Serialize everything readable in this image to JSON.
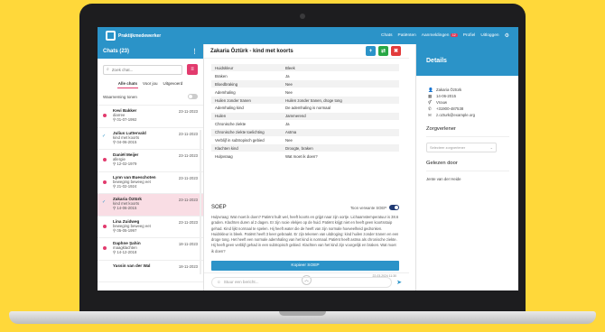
{
  "app": {
    "logo_text": "Praktijkmedewerker"
  },
  "topnav": {
    "items": [
      "Chats",
      "Patiënten"
    ],
    "notifications": "Aanmeldingen",
    "badge": "12",
    "profile": "Profiel",
    "logout": "Uitloggen",
    "settings_icon": "gear-icon"
  },
  "left": {
    "title": "Chats (23)",
    "search_placeholder": "Zoek chat...",
    "tabs": [
      "Alle chats",
      "Voor jou",
      "Uitgevoerd"
    ],
    "toggle_label": "Waarneming tonen",
    "chats": [
      {
        "name": "Kevi Bakker",
        "sub": "diarree",
        "date_line": "01-07-1992",
        "date": "23-11-2023",
        "marker": "dot"
      },
      {
        "name": "Julius Luttervald",
        "sub": "kind met koorts",
        "date_line": "04-06-2015",
        "date": "23-11-2023",
        "marker": "check"
      },
      {
        "name": "Daniël Meijer",
        "sub": "allergie",
        "date_line": "12-02-1979",
        "date": "23-11-2023",
        "marker": "dot"
      },
      {
        "name": "Lynn van Bueschoten",
        "sub": "beweging beweeg eet",
        "date_line": "21-02-1924",
        "date": "23-11-2023",
        "marker": "dot"
      },
      {
        "name": "Zakaria Öztürk",
        "sub": "kind met koorts",
        "date_line": "14-06-2015",
        "date": "23-11-2023",
        "marker": "check",
        "selected": true
      },
      {
        "name": "Lina Zuidweg",
        "sub": "beweging beweeg eet",
        "date_line": "05-05-1997",
        "date": "23-11-2023",
        "marker": "dot"
      },
      {
        "name": "Daphne Şahin",
        "sub": "maagklachten",
        "date_line": "14-12-2018",
        "date": "18-11-2023",
        "marker": "dot"
      },
      {
        "name": "Yassin van der Wal",
        "sub": "",
        "date_line": "",
        "date": "18-11-2023",
        "marker": "none"
      }
    ]
  },
  "middle": {
    "title": "Zakaria Öztürk - kind met koorts",
    "rows": [
      {
        "k": "Huidskleur",
        "v": "Bleek"
      },
      {
        "k": "Braken",
        "v": "Ja"
      },
      {
        "k": "Bloedbraking",
        "v": "Nee"
      },
      {
        "k": "Ademhaling",
        "v": "Nee"
      },
      {
        "k": "Huilen zonder tranen",
        "v": "Huilen zonder tranen, droge tong"
      },
      {
        "k": "Ademhaling kind",
        "v": "De ademhaling is normaal"
      },
      {
        "k": "Huilen",
        "v": "Jammerend"
      },
      {
        "k": "Chronische ziekte",
        "v": "Ja"
      },
      {
        "k": "Chronische ziekte toelichting",
        "v": "Astma"
      },
      {
        "k": "Verblijf in subtropisch gebied",
        "v": "Nee"
      },
      {
        "k": "Klachten kind",
        "v": "Droogte, braken"
      },
      {
        "k": "Hulpvraag",
        "v": "Wat moet ik doen?"
      }
    ],
    "soep_title": "SOEP",
    "soep_toggle": "Toon verwante SOEP",
    "soep_text": "Hulpvraag: Wat moet ik doen? Patiënt huilt wel, heeft koorts en grijpt naar zijn oortje. Lichaamstemperatuur is 38.6 graden. Klachten duren al 2 dagen. Er zijn rooie vlekjes op de huid. Patiënt krijgt niet en heeft geen koortsstuip gehad. Kind lijkt normaal te spelen. Hij heeft water die de heeft van zijn normale hoeveelheid gedronken. Huidskleur is bleek. Patiënt heeft 3 keer gebraakt. Er zijn tekenen van uitdroging: kind huilen zonder tranen en een droge tong. Het heeft een normale ademhaling van het kind is normaal. Patiënt heeft astma als chronische ziekte. Hij heeft geen verblijf gehad in een subtropisch gebied. Klachten van het kind zijn voorgelijk en braken. Wat moet ik doen?",
    "copy_button": "Kopieer SOEP",
    "soep_timestamp": "22-03-2024 11:30",
    "message_placeholder": "Stuur een bericht..."
  },
  "right": {
    "title": "Details",
    "details": [
      {
        "icon": "user-icon",
        "glyph": "👤",
        "text": "Zakaria Öztürk"
      },
      {
        "icon": "calendar-icon",
        "glyph": "▦",
        "text": "14-06-2015"
      },
      {
        "icon": "gender-icon",
        "glyph": "⚥",
        "text": "Vrouw"
      },
      {
        "icon": "phone-icon",
        "glyph": "✆",
        "text": "+31900-487538"
      },
      {
        "icon": "mail-icon",
        "glyph": "✉",
        "text": "z.ozturk@example.org"
      }
    ],
    "caregiver_title": "Zorgverlener",
    "caregiver_placeholder": "Selecteer zorgverlener",
    "read_by_title": "Gelezen door",
    "read_by_value": "Jente van der Heide"
  }
}
